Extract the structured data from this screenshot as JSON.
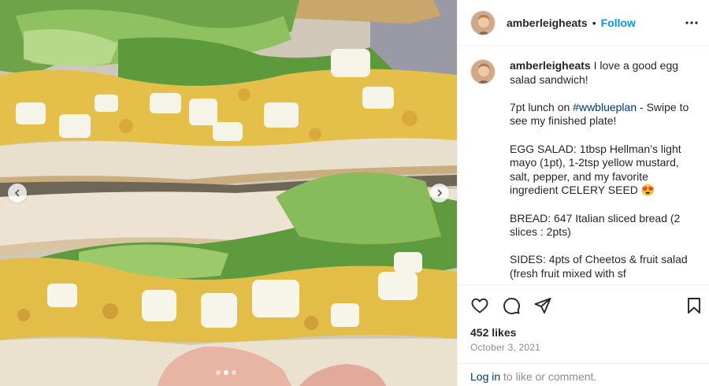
{
  "post": {
    "username": "amberleigheats",
    "separator": "•",
    "follow_label": "Follow",
    "more_icon": "more-horizontal-icon",
    "caption": {
      "username": "amberleigheats",
      "paragraphs": [
        {
          "text": "I love a good egg salad sandwich!"
        },
        {
          "prefix": "7pt lunch on ",
          "hashtag": "#wwblueplan",
          "suffix": " - Swipe to see my finished plate!"
        },
        {
          "text": "EGG SALAD: 1tbsp Hellman’s light mayo (1pt), 1-2tsp yellow mustard, salt, pepper, and my favorite ingredient CELERY SEED 😍"
        },
        {
          "text": "BREAD: 647 Italian sliced bread (2 slices : 2pts)"
        },
        {
          "text": "SIDES: 4pts of Cheetos & fruit salad (fresh fruit mixed with sf"
        }
      ]
    },
    "likes": "452 likes",
    "date": "October 3, 2021",
    "login": {
      "link": "Log in",
      "rest": " to like or comment."
    }
  },
  "carousel": {
    "slide_count": 3,
    "active_slide": 1,
    "prev_icon": "chevron-left-icon",
    "next_icon": "chevron-right-icon"
  },
  "actions": {
    "like_icon": "heart-icon",
    "comment_icon": "comment-icon",
    "share_icon": "send-icon",
    "save_icon": "bookmark-icon"
  },
  "colors": {
    "follow": "#0095f6",
    "hashtag": "#00376b",
    "muted": "#8e8e8e",
    "text": "#262626"
  }
}
